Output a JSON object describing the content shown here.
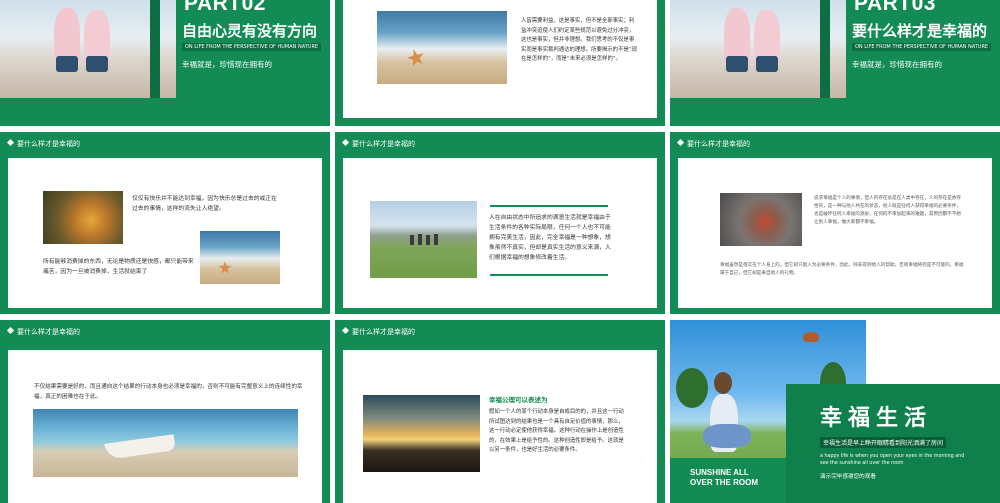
{
  "colors": {
    "primary_green": "#128b55",
    "dark_green": "#0c6e42",
    "text": "#333333"
  },
  "section_label": "要什么样才是幸福的",
  "part02": {
    "part_label": "PART02",
    "title": "自由心灵有没有方向",
    "english": "ON LIFE FROM THE PERSPECTIVE OF HUMAN NATURE",
    "subtitle": "幸福就是，珍惜现在拥有的"
  },
  "slide_starfish": {
    "paragraph": "人皆需要利益，这是事实，但不是全部事实；利益冲突迫使人们约定某些规范以避免过分冲突，这也是事实，但并非理想。我们思考的不仅是事实而是事实裁判通达的理想。所要揭示的不是“现在是怎样的”，而是“未来必须是怎样的”。"
  },
  "part03": {
    "part_label": "PART03",
    "title": "要什么样才是幸福的",
    "english": "ON LIFE FROM THE PERSPECTIVE OF HUMAN NATURE",
    "subtitle": "幸福就是，珍惜现在拥有的"
  },
  "slide_leaf": {
    "para1": "仅仅有快乐并不能达到幸福，因为快乐总是过去的或正在过去的事情，这样的流失让人绝望。",
    "para2": "所有能够消费掉的东西，无论是物质还是快感，都只能带来痛苦，因为一旦被消费掉，生活就结束了"
  },
  "slide_field": {
    "paragraph": "人在自由状态中所追求的满意生活就是幸福由于生活条件的各种实际局限，任何一个人也不可能拥有完美生活，因此，完全幸福是一种想象，想象虽然不真实，但却是真实生活的意义来源，人们根据幸福的想象修改着生活。"
  },
  "slide_redleaf": {
    "para1": "追求幸福是个人的事情，但人的存在总是在人类中存在，人的存在是依存性的，是一种与他人共在的状态，他人既是任何人获得幸福的必要条件，也是破坏任何人幸福的源泉，任何的不幸加起来的难题，其原因都不不想让别人幸福，做大家都不幸福。",
    "para2": "幸福虽然是落实在个人身上的，但它却只能入为必要条件，因此，除非得到他人的帮助，否则幸福将完是不可能的，幸福属于自己，但它却是来自他人的礼物。"
  },
  "slide_boat": {
    "paragraph": "不仅结果需要是好的，而且通向这个结果的行动本身也必须是幸福的，否则不可能有完整意义上的连续性的幸福，真正的困难也在于此。"
  },
  "slide_sunset": {
    "heading": "幸福公理可以表述为",
    "paragraph": "假如一个人的某个行动本身是自成目的的，并且这一行动所试图达到的结果也是一个具有自足价值的事情，那么，这一行动必定使他获得幸福。这种行动在操作上是创造性的，在效果上是给予性的。这种创造性即是给予。这就是以另一条件，也是好生活的必要条件。"
  },
  "slide_final": {
    "title": "幸福生活",
    "subtitle": "幸福生活是早上睁开眼睛看到阳光洒满了房间",
    "english": "a happy life is when you open your eyes in the morning and see the sunshine all over the room",
    "thanks": "演示完毕感谢您的观看",
    "sunshine": "SUNSHINE ALL OVER THE ROOM"
  }
}
